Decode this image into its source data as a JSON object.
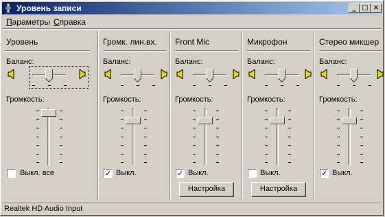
{
  "window": {
    "title": "Уровень записи"
  },
  "menu": [
    {
      "label": "Параметры",
      "accel": "П"
    },
    {
      "label": "Справка",
      "accel": "С"
    }
  ],
  "master": {
    "title": "Уровень",
    "balance_label": "Баланс:",
    "volume_label": "Громкость:",
    "volume_level": 0.95,
    "mute_label": "Выкл. все",
    "mute_checked": false
  },
  "channels": [
    {
      "title": "Громк. лин.вх.",
      "balance_label": "Баланс:",
      "volume_label": "Громкость:",
      "volume_level": 0.8,
      "mute_label": "Выкл.",
      "mute_checked": true,
      "button_label": ""
    },
    {
      "title": "Front Mic",
      "balance_label": "Баланс:",
      "volume_label": "Громкость:",
      "volume_level": 0.8,
      "mute_label": "Выкл.",
      "mute_checked": true,
      "button_label": "Настройка"
    },
    {
      "title": "Микрофон",
      "balance_label": "Баланс:",
      "volume_label": "Громкость:",
      "volume_level": 0.8,
      "mute_label": "Выкл.",
      "mute_checked": false,
      "button_label": "Настройка"
    },
    {
      "title": "Стерео микшер",
      "balance_label": "Баланс:",
      "volume_label": "Громкость:",
      "volume_level": 0.8,
      "mute_label": "Выкл.",
      "mute_checked": true,
      "button_label": ""
    }
  ],
  "status": {
    "text": "Realtek HD Audio Input"
  },
  "colors": {
    "title_start": "#0a246a",
    "title_end": "#a6caf0",
    "face": "#d4d0c8",
    "speaker": "#e8d800"
  }
}
